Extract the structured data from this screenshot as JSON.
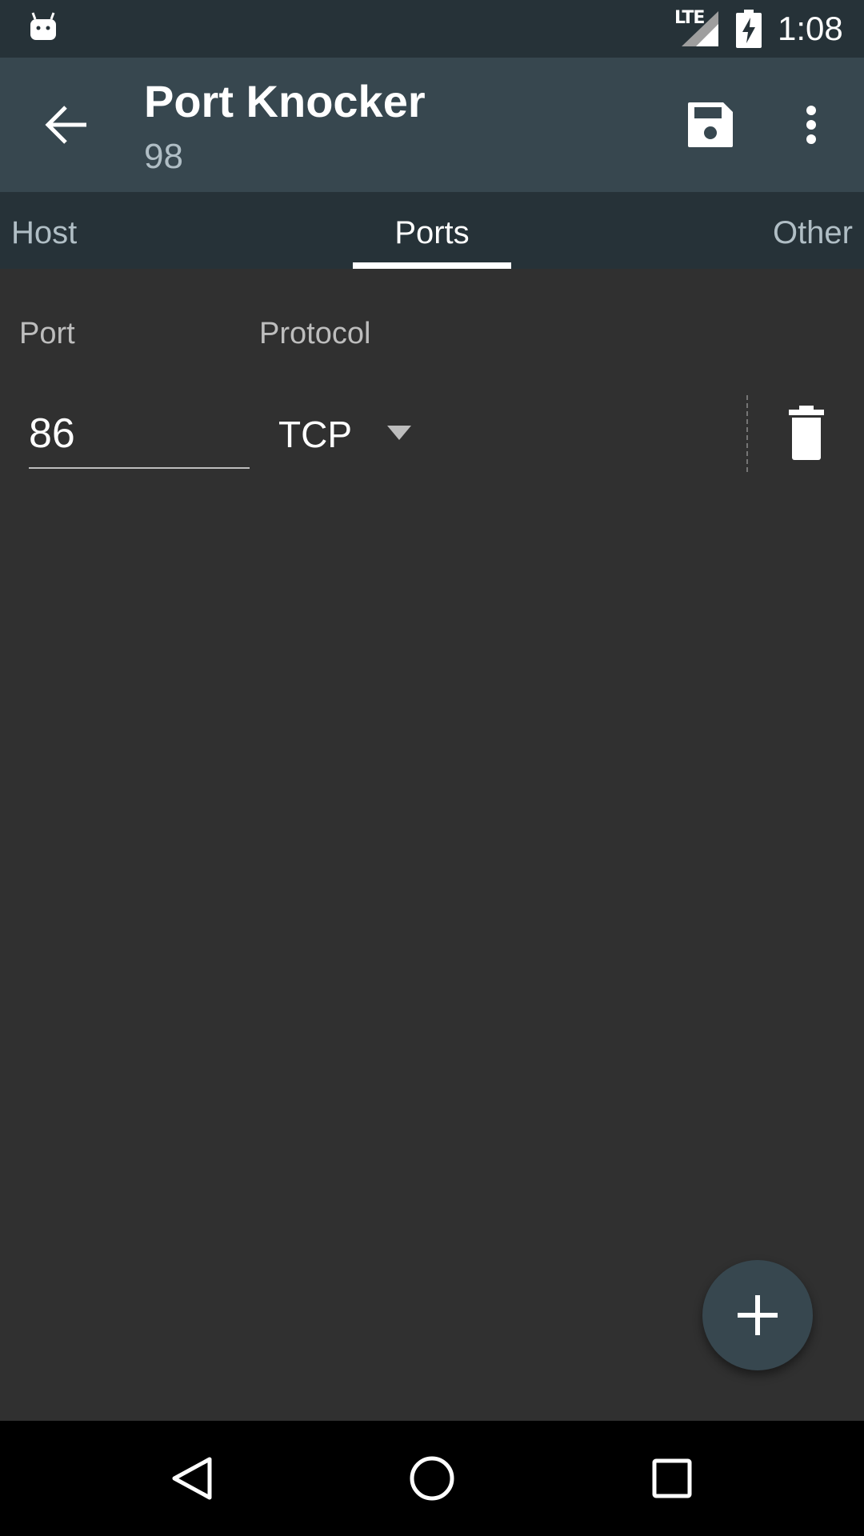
{
  "status_bar": {
    "network_label": "LTE",
    "time": "1:08",
    "icons": [
      "android-notification-icon",
      "signal-icon",
      "battery-charging-icon"
    ]
  },
  "app_bar": {
    "title": "Port Knocker",
    "subtitle": "98",
    "icons": [
      "back-arrow-icon",
      "save-icon",
      "more-vert-icon"
    ]
  },
  "tabs": [
    {
      "label": "Host",
      "selected": false
    },
    {
      "label": "Ports",
      "selected": true
    },
    {
      "label": "Other",
      "selected": false
    }
  ],
  "form": {
    "port_label": "Port",
    "protocol_label": "Protocol",
    "port_value": "86",
    "protocol_value": "TCP"
  },
  "fab": {
    "icon": "plus-icon"
  },
  "nav": {
    "icons": [
      "nav-back-icon",
      "nav-home-icon",
      "nav-recents-icon"
    ]
  },
  "colors": {
    "status_bar": "#263238",
    "app_bar": "#37474f",
    "tab_bar": "#263238",
    "background": "#303030",
    "fab": "#37474f",
    "nav_bar": "#000000"
  }
}
